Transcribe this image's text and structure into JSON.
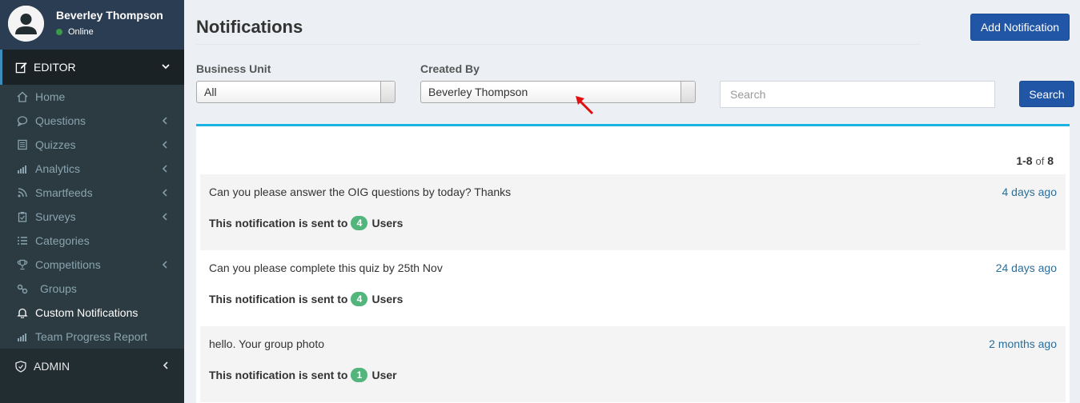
{
  "user": {
    "name": "Beverley Thompson",
    "status": "Online"
  },
  "sidebar": {
    "editor_label": "EDITOR",
    "admin_label": "ADMIN",
    "items": [
      {
        "label": "Home",
        "icon": "home-icon",
        "has_submenu": false
      },
      {
        "label": "Questions",
        "icon": "chat-icon",
        "has_submenu": true
      },
      {
        "label": "Quizzes",
        "icon": "document-icon",
        "has_submenu": true
      },
      {
        "label": "Analytics",
        "icon": "bar-chart-icon",
        "has_submenu": true
      },
      {
        "label": "Smartfeeds",
        "icon": "feed-icon",
        "has_submenu": true
      },
      {
        "label": "Surveys",
        "icon": "clipboard-icon",
        "has_submenu": true
      },
      {
        "label": "Categories",
        "icon": "list-icon",
        "has_submenu": false
      },
      {
        "label": "Competitions",
        "icon": "trophy-icon",
        "has_submenu": true
      },
      {
        "label": "Groups",
        "icon": "link-icon",
        "has_submenu": false
      },
      {
        "label": "Custom Notifications",
        "icon": "bell-icon",
        "has_submenu": false,
        "active": true
      },
      {
        "label": "Team Progress Report",
        "icon": "bar-chart-icon",
        "has_submenu": false
      }
    ]
  },
  "header": {
    "title": "Notifications",
    "add_button": "Add Notification"
  },
  "filters": {
    "business_unit_label": "Business Unit",
    "business_unit_value": "All",
    "created_by_label": "Created By",
    "created_by_value": "Beverley Thompson",
    "search_placeholder": "Search",
    "search_button": "Search"
  },
  "pager": {
    "range": "1-8",
    "of": "of",
    "total": "8"
  },
  "notifications": [
    {
      "message": "Can you please answer the OIG questions by today? Thanks",
      "time": "4 days ago",
      "sent_prefix": "This notification is sent to",
      "count": "4",
      "unit": "Users"
    },
    {
      "message": "Can you please complete this quiz by 25th Nov",
      "time": "24 days ago",
      "sent_prefix": "This notification is sent to",
      "count": "4",
      "unit": "Users"
    },
    {
      "message": "hello. Your group photo",
      "time": "2 months ago",
      "sent_prefix": "This notification is sent to",
      "count": "1",
      "unit": "User"
    }
  ],
  "colors": {
    "accent": "#1ab4e3",
    "primary_button": "#2156a7",
    "badge": "#52b57c",
    "link": "#2a6f9c"
  }
}
